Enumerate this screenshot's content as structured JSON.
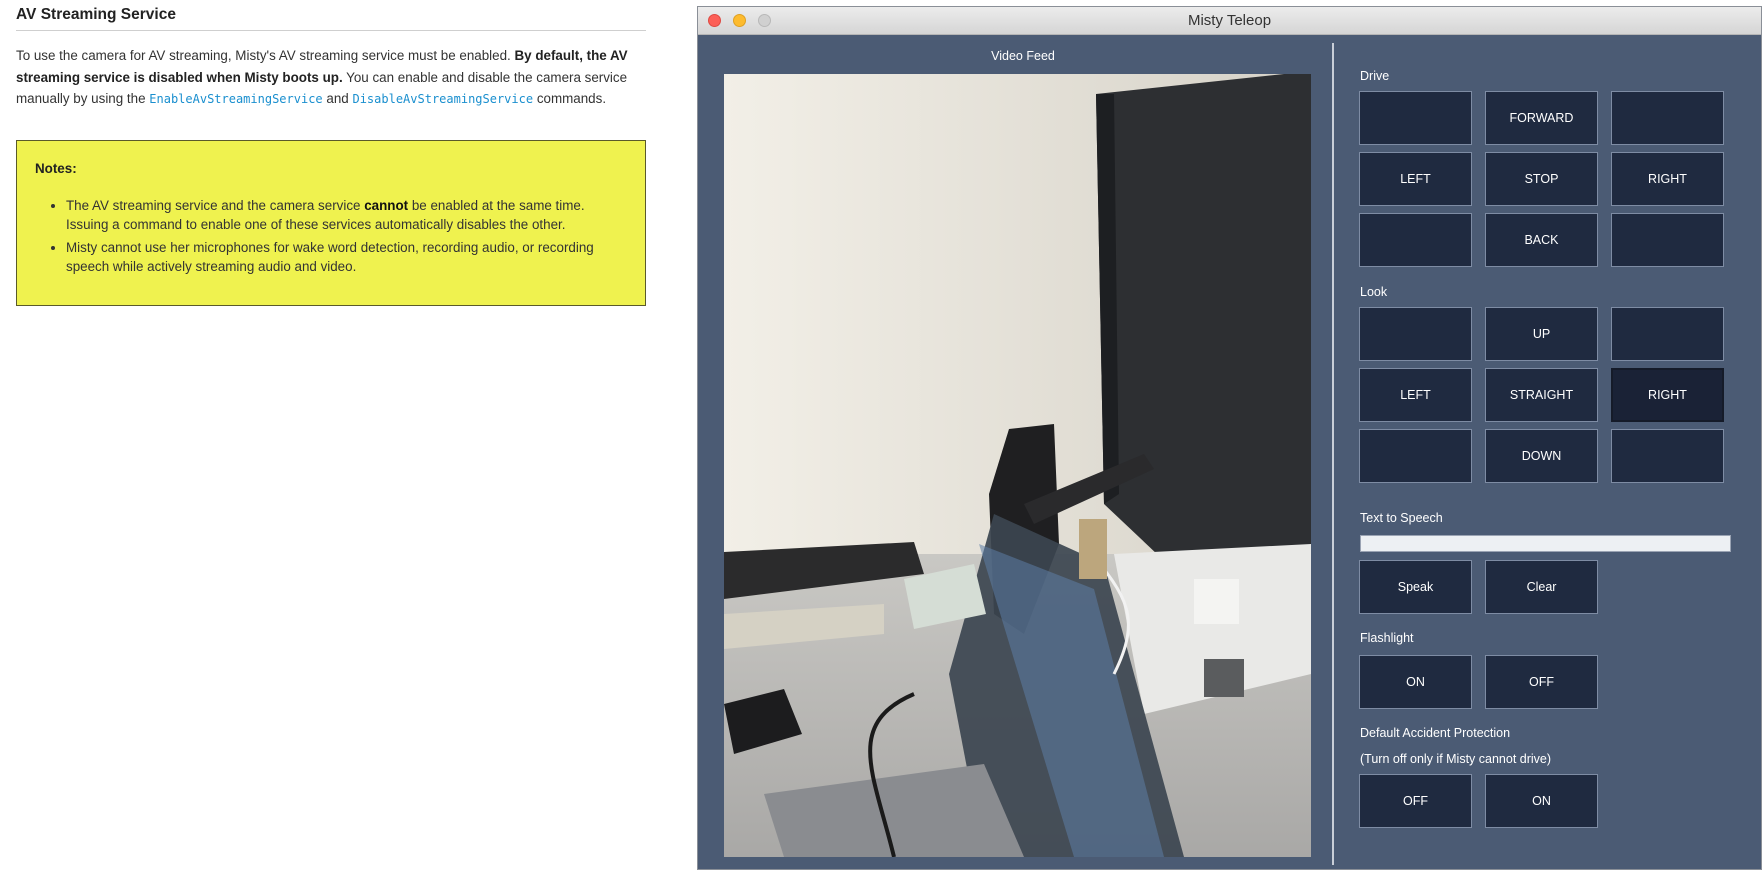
{
  "doc": {
    "title": "AV Streaming Service",
    "para_1": "To use the camera for AV streaming, Misty's AV streaming service must be enabled.",
    "para_bold": "By default, the AV streaming service is disabled when Misty boots up.",
    "para_2": "You can enable and disable the camera service manually by using the",
    "code_enable": "EnableAvStreamingService",
    "para_and": "and",
    "code_disable": "DisableAvStreamingService",
    "para_end": "commands.",
    "note_head": "Notes:",
    "note_1a": "The AV streaming service and the camera service",
    "note_1_bold": "cannot",
    "note_1b": "be enabled at the same time. Issuing a command to enable one of these services automatically disables the other.",
    "note_2": "Misty cannot use her microphones for wake word detection, recording audio, or recording speech while actively streaming audio and video."
  },
  "window": {
    "title": "Misty Teleop",
    "video_label": "Video Feed",
    "drive": {
      "label": "Drive",
      "forward": "FORWARD",
      "left": "LEFT",
      "stop": "STOP",
      "right": "RIGHT",
      "back": "BACK"
    },
    "look": {
      "label": "Look",
      "up": "UP",
      "left": "LEFT",
      "straight": "STRAIGHT",
      "right": "RIGHT",
      "down": "DOWN"
    },
    "tts": {
      "label": "Text to Speech",
      "value": "",
      "speak": "Speak",
      "clear": "Clear"
    },
    "flashlight": {
      "label": "Flashlight",
      "on": "ON",
      "off": "OFF"
    },
    "accident": {
      "label": "Default Accident Protection",
      "sublabel": "(Turn off only if Misty cannot drive)",
      "off": "OFF",
      "on": "ON"
    }
  },
  "colors": {
    "window_bg": "#4b5b74",
    "button_bg": "#1f2a40",
    "note_bg": "#eff24f",
    "code_color": "#1a8fcf"
  }
}
